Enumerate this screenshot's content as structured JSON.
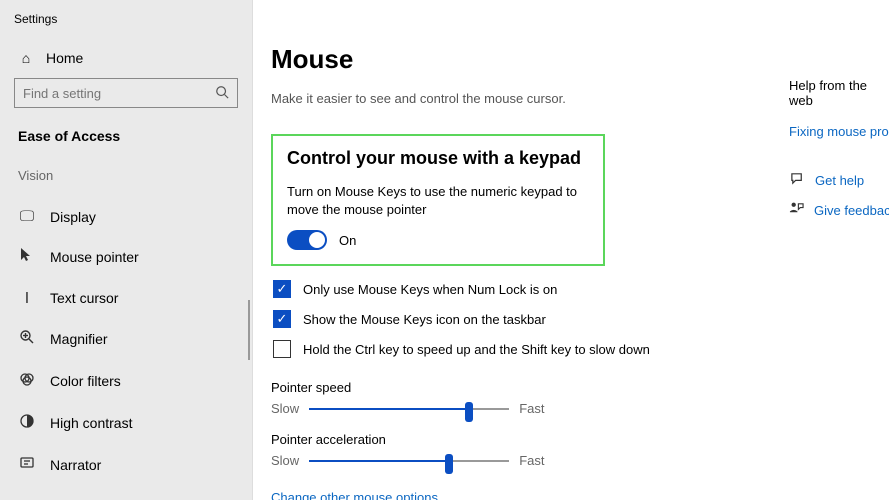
{
  "window": {
    "title": "Settings"
  },
  "sidebar": {
    "home": "Home",
    "search_placeholder": "Find a setting",
    "section": "Ease of Access",
    "group": "Vision",
    "items": [
      {
        "icon": "display",
        "label": "Display"
      },
      {
        "icon": "cursor",
        "label": "Mouse pointer"
      },
      {
        "icon": "textcursor",
        "label": "Text cursor"
      },
      {
        "icon": "magnifier",
        "label": "Magnifier"
      },
      {
        "icon": "colorfilters",
        "label": "Color filters"
      },
      {
        "icon": "highcontrast",
        "label": "High contrast"
      },
      {
        "icon": "narrator",
        "label": "Narrator"
      }
    ]
  },
  "page": {
    "title": "Mouse",
    "subtitle": "Make it easier to see and control the mouse cursor.",
    "keypad": {
      "heading": "Control your mouse with a keypad",
      "desc": "Turn on Mouse Keys to use the numeric keypad to move the mouse pointer",
      "toggle_state": "On"
    },
    "checks": [
      {
        "checked": true,
        "label": "Only use Mouse Keys when Num Lock is on"
      },
      {
        "checked": true,
        "label": "Show the Mouse Keys icon on the taskbar"
      },
      {
        "checked": false,
        "label": "Hold the Ctrl key to speed up and the Shift key to slow down"
      }
    ],
    "sliders": [
      {
        "title": "Pointer speed",
        "low": "Slow",
        "high": "Fast",
        "value_pct": 80
      },
      {
        "title": "Pointer acceleration",
        "low": "Slow",
        "high": "Fast",
        "value_pct": 70
      }
    ],
    "link": "Change other mouse options"
  },
  "rail": {
    "title": "Help from the web",
    "link1": "Fixing mouse proble",
    "help": "Get help",
    "feedback": "Give feedback"
  }
}
